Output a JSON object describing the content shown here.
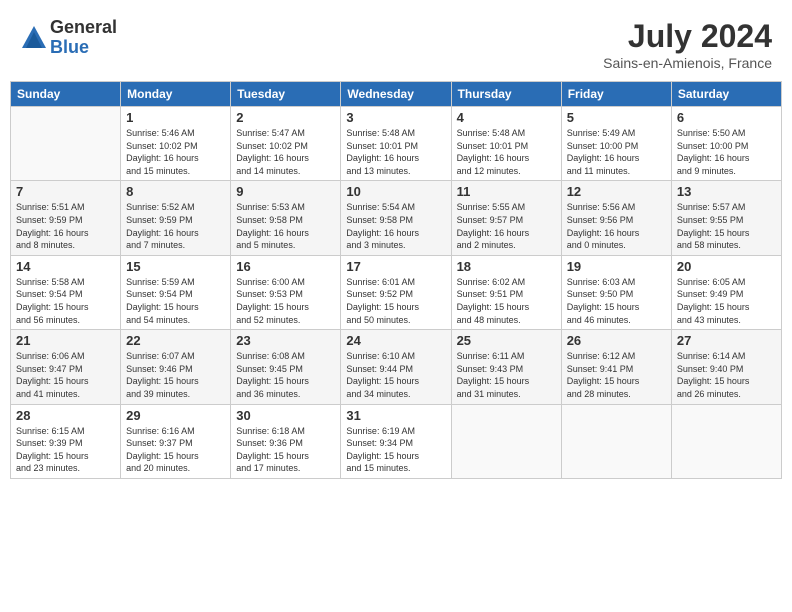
{
  "header": {
    "logo": {
      "general": "General",
      "blue": "Blue"
    },
    "title": "July 2024",
    "location": "Sains-en-Amienois, France"
  },
  "days_of_week": [
    "Sunday",
    "Monday",
    "Tuesday",
    "Wednesday",
    "Thursday",
    "Friday",
    "Saturday"
  ],
  "weeks": [
    [
      {
        "day": "",
        "info": ""
      },
      {
        "day": "1",
        "info": "Sunrise: 5:46 AM\nSunset: 10:02 PM\nDaylight: 16 hours\nand 15 minutes."
      },
      {
        "day": "2",
        "info": "Sunrise: 5:47 AM\nSunset: 10:02 PM\nDaylight: 16 hours\nand 14 minutes."
      },
      {
        "day": "3",
        "info": "Sunrise: 5:48 AM\nSunset: 10:01 PM\nDaylight: 16 hours\nand 13 minutes."
      },
      {
        "day": "4",
        "info": "Sunrise: 5:48 AM\nSunset: 10:01 PM\nDaylight: 16 hours\nand 12 minutes."
      },
      {
        "day": "5",
        "info": "Sunrise: 5:49 AM\nSunset: 10:00 PM\nDaylight: 16 hours\nand 11 minutes."
      },
      {
        "day": "6",
        "info": "Sunrise: 5:50 AM\nSunset: 10:00 PM\nDaylight: 16 hours\nand 9 minutes."
      }
    ],
    [
      {
        "day": "7",
        "info": "Sunrise: 5:51 AM\nSunset: 9:59 PM\nDaylight: 16 hours\nand 8 minutes."
      },
      {
        "day": "8",
        "info": "Sunrise: 5:52 AM\nSunset: 9:59 PM\nDaylight: 16 hours\nand 7 minutes."
      },
      {
        "day": "9",
        "info": "Sunrise: 5:53 AM\nSunset: 9:58 PM\nDaylight: 16 hours\nand 5 minutes."
      },
      {
        "day": "10",
        "info": "Sunrise: 5:54 AM\nSunset: 9:58 PM\nDaylight: 16 hours\nand 3 minutes."
      },
      {
        "day": "11",
        "info": "Sunrise: 5:55 AM\nSunset: 9:57 PM\nDaylight: 16 hours\nand 2 minutes."
      },
      {
        "day": "12",
        "info": "Sunrise: 5:56 AM\nSunset: 9:56 PM\nDaylight: 16 hours\nand 0 minutes."
      },
      {
        "day": "13",
        "info": "Sunrise: 5:57 AM\nSunset: 9:55 PM\nDaylight: 15 hours\nand 58 minutes."
      }
    ],
    [
      {
        "day": "14",
        "info": "Sunrise: 5:58 AM\nSunset: 9:54 PM\nDaylight: 15 hours\nand 56 minutes."
      },
      {
        "day": "15",
        "info": "Sunrise: 5:59 AM\nSunset: 9:54 PM\nDaylight: 15 hours\nand 54 minutes."
      },
      {
        "day": "16",
        "info": "Sunrise: 6:00 AM\nSunset: 9:53 PM\nDaylight: 15 hours\nand 52 minutes."
      },
      {
        "day": "17",
        "info": "Sunrise: 6:01 AM\nSunset: 9:52 PM\nDaylight: 15 hours\nand 50 minutes."
      },
      {
        "day": "18",
        "info": "Sunrise: 6:02 AM\nSunset: 9:51 PM\nDaylight: 15 hours\nand 48 minutes."
      },
      {
        "day": "19",
        "info": "Sunrise: 6:03 AM\nSunset: 9:50 PM\nDaylight: 15 hours\nand 46 minutes."
      },
      {
        "day": "20",
        "info": "Sunrise: 6:05 AM\nSunset: 9:49 PM\nDaylight: 15 hours\nand 43 minutes."
      }
    ],
    [
      {
        "day": "21",
        "info": "Sunrise: 6:06 AM\nSunset: 9:47 PM\nDaylight: 15 hours\nand 41 minutes."
      },
      {
        "day": "22",
        "info": "Sunrise: 6:07 AM\nSunset: 9:46 PM\nDaylight: 15 hours\nand 39 minutes."
      },
      {
        "day": "23",
        "info": "Sunrise: 6:08 AM\nSunset: 9:45 PM\nDaylight: 15 hours\nand 36 minutes."
      },
      {
        "day": "24",
        "info": "Sunrise: 6:10 AM\nSunset: 9:44 PM\nDaylight: 15 hours\nand 34 minutes."
      },
      {
        "day": "25",
        "info": "Sunrise: 6:11 AM\nSunset: 9:43 PM\nDaylight: 15 hours\nand 31 minutes."
      },
      {
        "day": "26",
        "info": "Sunrise: 6:12 AM\nSunset: 9:41 PM\nDaylight: 15 hours\nand 28 minutes."
      },
      {
        "day": "27",
        "info": "Sunrise: 6:14 AM\nSunset: 9:40 PM\nDaylight: 15 hours\nand 26 minutes."
      }
    ],
    [
      {
        "day": "28",
        "info": "Sunrise: 6:15 AM\nSunset: 9:39 PM\nDaylight: 15 hours\nand 23 minutes."
      },
      {
        "day": "29",
        "info": "Sunrise: 6:16 AM\nSunset: 9:37 PM\nDaylight: 15 hours\nand 20 minutes."
      },
      {
        "day": "30",
        "info": "Sunrise: 6:18 AM\nSunset: 9:36 PM\nDaylight: 15 hours\nand 17 minutes."
      },
      {
        "day": "31",
        "info": "Sunrise: 6:19 AM\nSunset: 9:34 PM\nDaylight: 15 hours\nand 15 minutes."
      },
      {
        "day": "",
        "info": ""
      },
      {
        "day": "",
        "info": ""
      },
      {
        "day": "",
        "info": ""
      }
    ]
  ]
}
